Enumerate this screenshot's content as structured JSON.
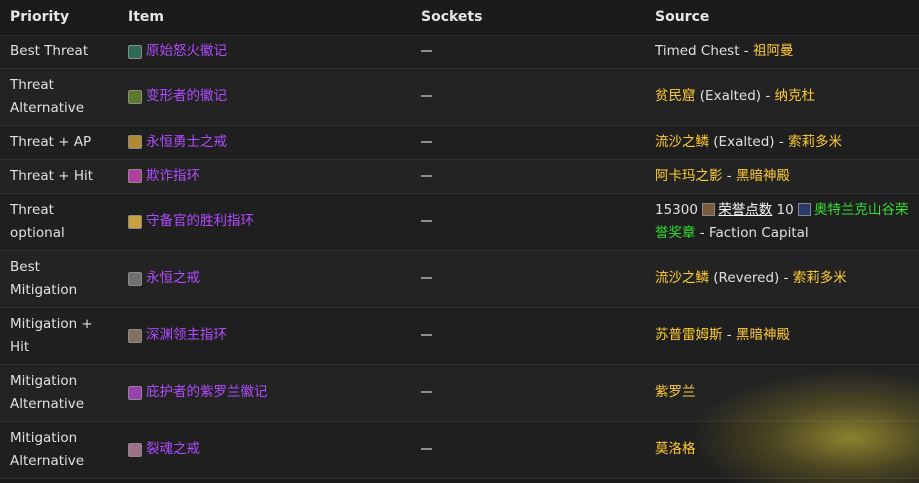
{
  "headers": {
    "priority": "Priority",
    "item": "Item",
    "sockets": "Sockets",
    "source": "Source"
  },
  "rows": [
    {
      "priority": "Best Threat",
      "item": "原始怒火徽记",
      "icon": "trinket-icon",
      "icon_color": "#2f6b55",
      "source": {
        "type": "plain",
        "prefix": "Timed Chest - ",
        "zone": "祖阿曼"
      }
    },
    {
      "priority": "Threat Alternative",
      "item": "变形者的徽记",
      "icon": "trinket-icon",
      "icon_color": "#5c7a2a",
      "source": {
        "type": "rep",
        "faction": "贫民窟",
        "rep": " (Exalted) - ",
        "zone": "纳克杜"
      }
    },
    {
      "priority": "Threat + AP",
      "item": "永恒勇士之戒",
      "icon": "ring-icon",
      "icon_color": "#b08a30",
      "source": {
        "type": "rep",
        "faction": "流沙之鳞",
        "rep": " (Exalted) - ",
        "zone": "索莉多米"
      }
    },
    {
      "priority": "Threat + Hit",
      "item": "欺诈指环",
      "icon": "ring-icon",
      "icon_color": "#b040a0",
      "source": {
        "type": "drop",
        "boss": "阿卡玛之影",
        "sep": " - ",
        "zone": "黑暗神殿"
      }
    },
    {
      "priority": "Threat optional",
      "item": "守备官的胜利指环",
      "icon": "ring-icon",
      "icon_color": "#c8a040",
      "source": {
        "type": "pvp",
        "honor": "15300",
        "honor_label": "荣誉点数",
        "marks": "10",
        "marks_label": "奥特兰克山谷荣誉奖章",
        "suffix": " - Faction Capital"
      }
    },
    {
      "priority": "Best Mitigation",
      "item": "永恒之戒",
      "icon": "ring-icon",
      "icon_color": "#707070",
      "source": {
        "type": "rep",
        "faction": "流沙之鳞",
        "rep": " (Revered) - ",
        "zone": "索莉多米"
      }
    },
    {
      "priority": "Mitigation + Hit",
      "item": "深渊领主指环",
      "icon": "ring-icon",
      "icon_color": "#807060",
      "source": {
        "type": "drop",
        "boss": "苏普雷姆斯",
        "sep": " - ",
        "zone": "黑暗神殿"
      }
    },
    {
      "priority": "Mitigation Alternative",
      "item": "庇护者的紫罗兰徽记",
      "icon": "trinket-icon",
      "icon_color": "#9a40b0",
      "source": {
        "type": "partial",
        "text": "紫罗兰"
      }
    },
    {
      "priority": "Mitigation Alternative",
      "item": "裂魂之戒",
      "icon": "ring-icon",
      "icon_color": "#a0708a",
      "source": {
        "type": "partial",
        "text": "莫洛格"
      }
    }
  ]
}
